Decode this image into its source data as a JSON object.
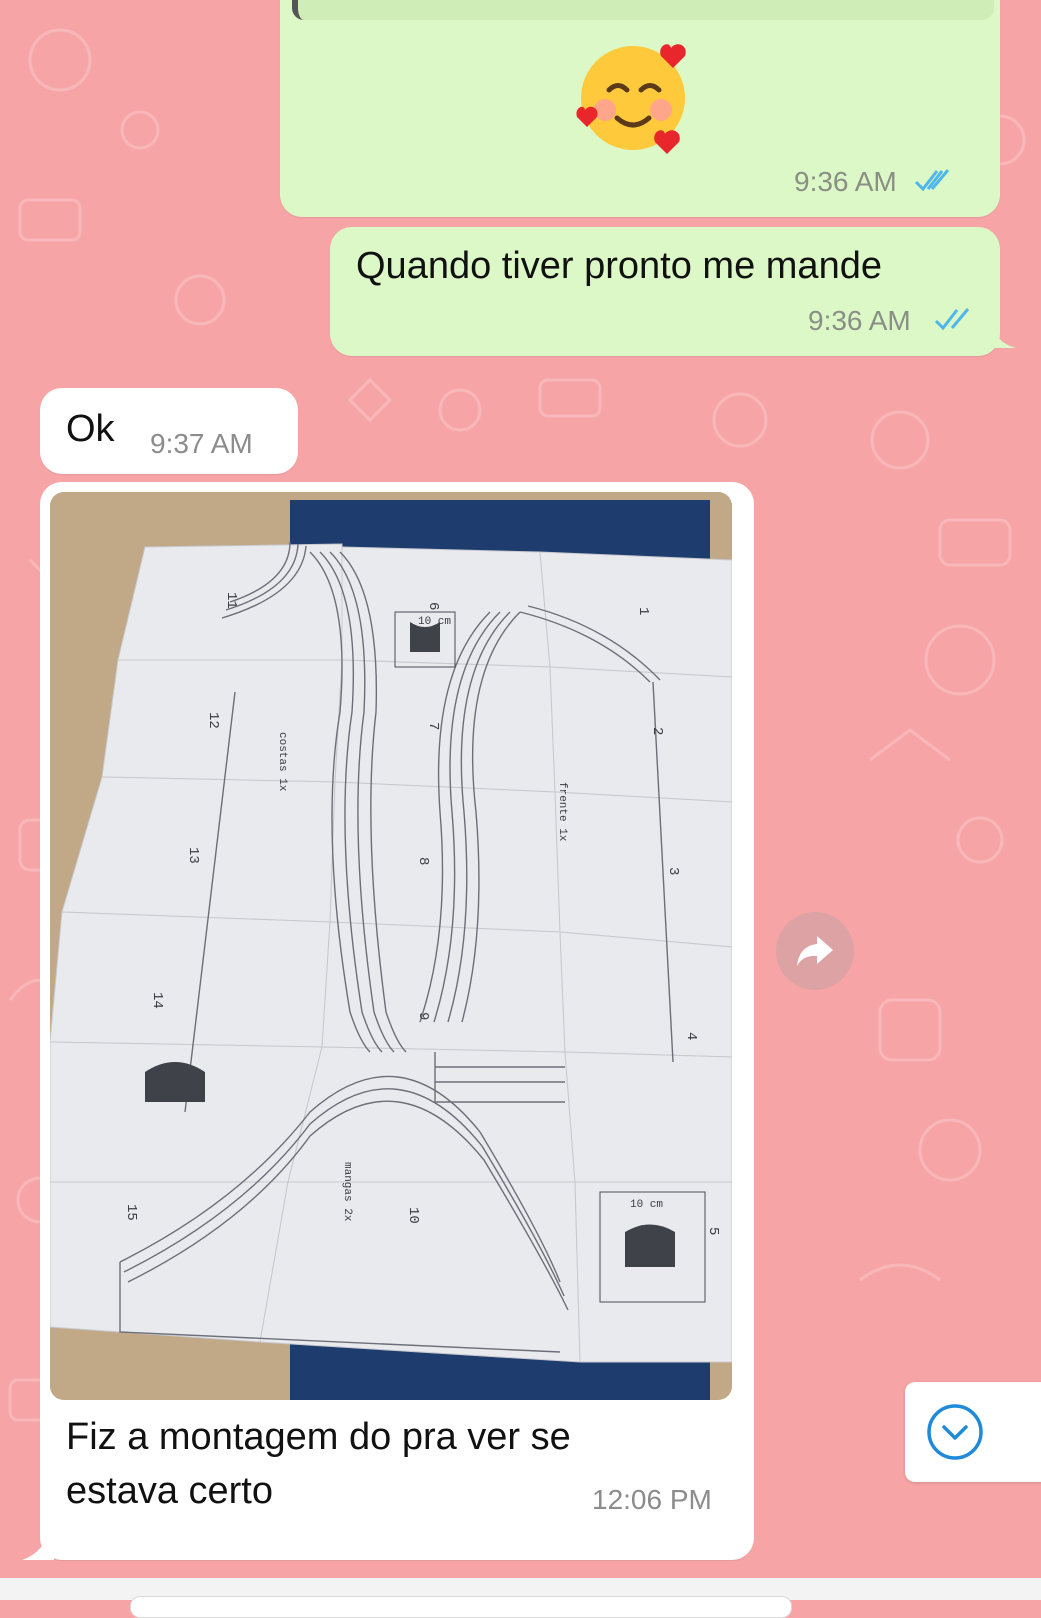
{
  "chat": {
    "messages": [
      {
        "id": "emoji",
        "direction": "outgoing",
        "emoji": "🥰",
        "time": "9:36 AM",
        "status": "read"
      },
      {
        "id": "quando",
        "direction": "outgoing",
        "text": "Quando tiver pronto me mande",
        "time": "9:36 AM",
        "status": "read"
      },
      {
        "id": "ok",
        "direction": "incoming",
        "text": "Ok",
        "time": "9:37 AM"
      },
      {
        "id": "photo",
        "direction": "incoming",
        "caption_line1": "Fiz a montagem  do pra ver se",
        "caption_line2": "estava certo",
        "time": "12:06 PM",
        "pattern_labels": {
          "costas": "costas 1x",
          "frente": "frente 1x",
          "mangas": "mangas 2x",
          "scale": "10 cm",
          "page_numbers": [
            "1",
            "2",
            "3",
            "4",
            "5",
            "6",
            "7",
            "8",
            "9",
            "10",
            "11",
            "12",
            "13",
            "14",
            "15"
          ]
        }
      }
    ]
  },
  "icons": {
    "read_ticks": "double-check-icon",
    "forward": "forward-icon",
    "scroll_down": "chevron-down-icon"
  },
  "colors": {
    "wallpaper": "#f7a4a6",
    "outgoing_bubble": "#dcf8c6",
    "incoming_bubble": "#ffffff",
    "read_tick": "#4fb6ec",
    "accent": "#1f8ad8"
  }
}
